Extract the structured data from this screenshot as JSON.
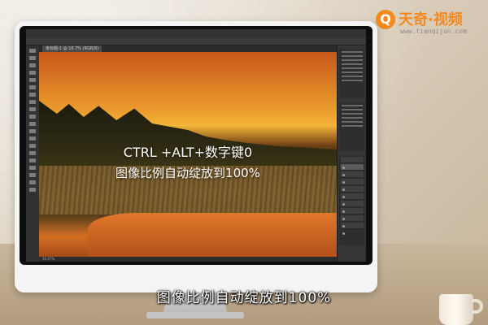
{
  "brand": {
    "logo_glyph": "Q",
    "name": "天奇·视频",
    "url": "www.tianqijun.com",
    "accent_color": "#f28a1f"
  },
  "photoshop": {
    "tab_label": "未标题-1 @ 16.7% (RGB/8)",
    "status_text": "16.67%",
    "overlay_line1": "CTRL +ALT+数字键0",
    "overlay_line2": "图像比例自动绽放到100%"
  },
  "subtitle": "图像比例自动绽放到100%"
}
